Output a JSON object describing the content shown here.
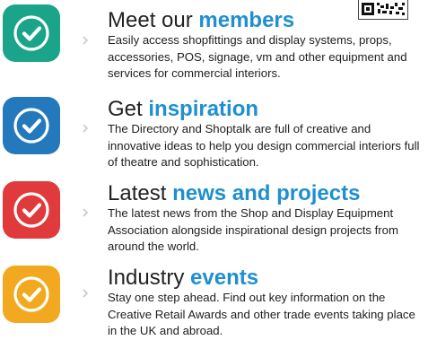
{
  "colors": {
    "accent": "#1f8fd0",
    "teal": "#1aa489",
    "blue": "#2479bd",
    "red": "#e13a3c",
    "amber": "#f2a91f"
  },
  "features": [
    {
      "icon": "check-circle-icon",
      "color": "#1aa489",
      "title_plain": "Meet our",
      "title_emphasis": "members",
      "description": "Easily access shopfittings and display systems, props, accessories, POS, signage, vm and other equipment and services for commercial interiors."
    },
    {
      "icon": "check-circle-icon",
      "color": "#2479bd",
      "title_plain": "Get",
      "title_emphasis": "inspiration",
      "description": "The Directory and Shoptalk are full of creative and innovative ideas to help you design commercial interiors full of theatre and sophistication."
    },
    {
      "icon": "check-circle-icon",
      "color": "#e13a3c",
      "title_plain": "Latest",
      "title_emphasis": "news and projects",
      "description": "The latest news from the Shop and Display Equipment Association alongside inspirational design projects from around the world."
    },
    {
      "icon": "check-circle-icon",
      "color": "#f2a91f",
      "title_plain": "Industry",
      "title_emphasis": "events",
      "description": "Stay one step ahead. Find out key information on the Creative Retail Awards and other trade events taking place in the UK and abroad."
    }
  ]
}
